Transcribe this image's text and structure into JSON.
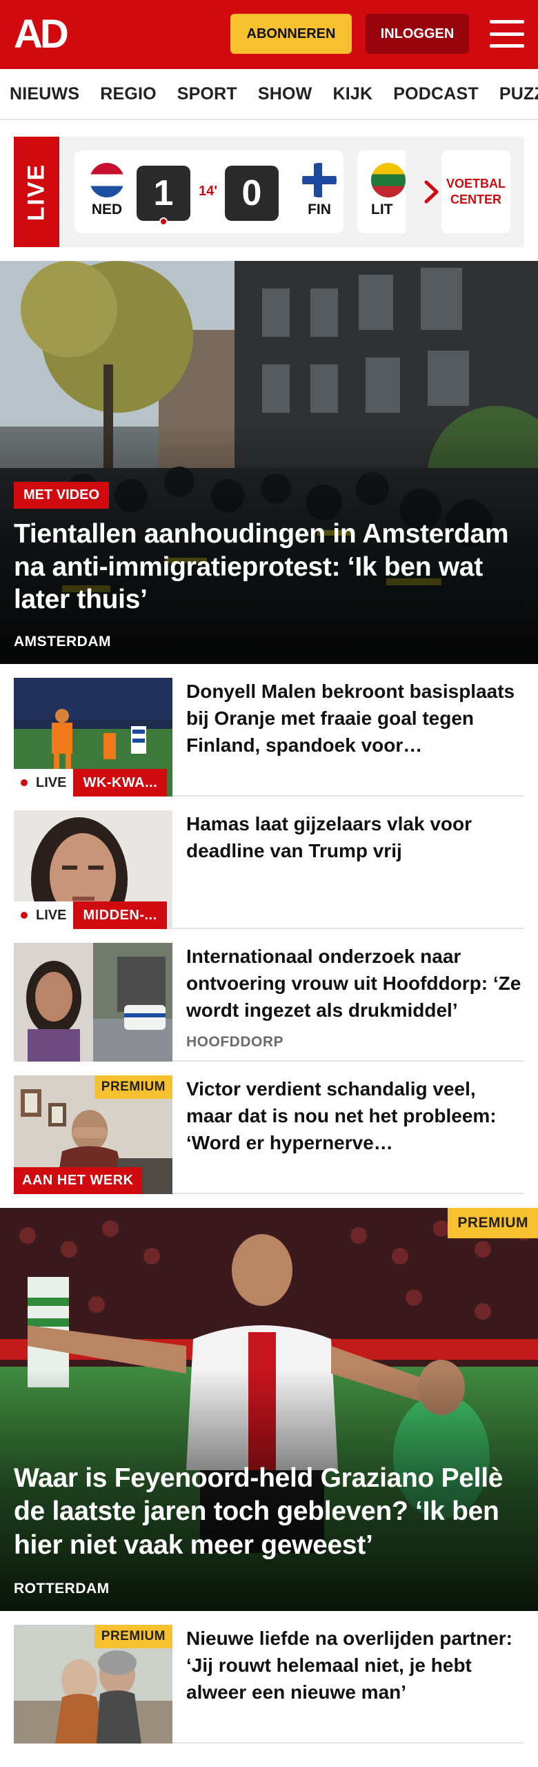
{
  "header": {
    "logo": "AD",
    "subscribe_label": "ABONNEREN",
    "login_label": "INLOGGEN",
    "brand_color": "#d10a10",
    "accent_color": "#f7c02f"
  },
  "nav": {
    "items": [
      "NIEUWS",
      "REGIO",
      "SPORT",
      "SHOW",
      "KIJK",
      "PODCAST",
      "PUZZELS"
    ]
  },
  "live": {
    "label": "LIVE",
    "match": {
      "home_code": "NED",
      "away_code": "FIN",
      "home_score": "1",
      "away_score": "0",
      "minute": "14'"
    },
    "next_match_code": "LIT",
    "voetbal_center_label": "VOETBAL CENTER"
  },
  "hero": {
    "badge": "MET VIDEO",
    "title": "Tientallen aanhoudingen in Amsterdam na anti-immigratiepro­test: ‘Ik ben wat later thuis’",
    "location": "AMSTERDAM"
  },
  "articles": [
    {
      "title": "Donyell Malen bekroont basis­plaats bij Oranje met fraaie goal tegen Finland, spandoek voor…",
      "live_label": "LIVE",
      "section": "WK-KWA..."
    },
    {
      "title": "Hamas laat gijzelaars vlak voor deadline van Trump vrij",
      "live_label": "LIVE",
      "section": "MIDDEN-..."
    },
    {
      "title": "Internationaal onderzoek naar ontvoering vrouw uit Hoofddorp: ‘Ze wordt ingezet als drukmiddel’",
      "location": "HOOFDDORP"
    },
    {
      "title": "Victor verdient schandalig veel, maar dat is nou net het probleem: ‘Word er hypernerve…",
      "premium": "PREMIUM",
      "section": "AAN HET WERK"
    }
  ],
  "feature": {
    "premium": "PREMIUM",
    "title": "Waar is Feyenoord-held Graziano Pellè de laatste jaren toch gebleven? ‘Ik ben hier niet vaak meer geweest’",
    "location": "ROTTERDAM"
  },
  "article_after_feature": {
    "premium": "PREMIUM",
    "title": "Nieuwe liefde na overlijden partner: ‘Jij rouwt helemaal niet, je hebt alweer een nieuwe man’"
  }
}
